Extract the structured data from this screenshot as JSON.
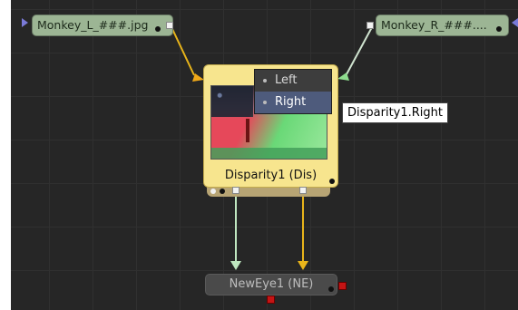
{
  "nodes": {
    "loader_left": {
      "label": "Monkey_L_###.jpg"
    },
    "loader_right": {
      "label": "Monkey_R_###...."
    },
    "disparity": {
      "label": "Disparity1  (Dis)"
    },
    "neweye": {
      "label": "NewEye1  (NE)"
    }
  },
  "view_menu": {
    "items": [
      {
        "label": "Left",
        "selected": false
      },
      {
        "label": "Right",
        "selected": true
      }
    ]
  },
  "tooltip": {
    "text": "Disparity1.Right"
  },
  "colors": {
    "canvas": "#262626",
    "loader": "#9cb594",
    "disparity_node": "#f7e58e",
    "wire_yellow": "#e8b41a",
    "wire_green": "#bfe7c0",
    "menu_selected": "#4e5b7c",
    "output_red": "#c41414"
  },
  "icons": {
    "input_arrow": "triangle-right-icon",
    "output_arrow": "triangle-left-icon"
  }
}
